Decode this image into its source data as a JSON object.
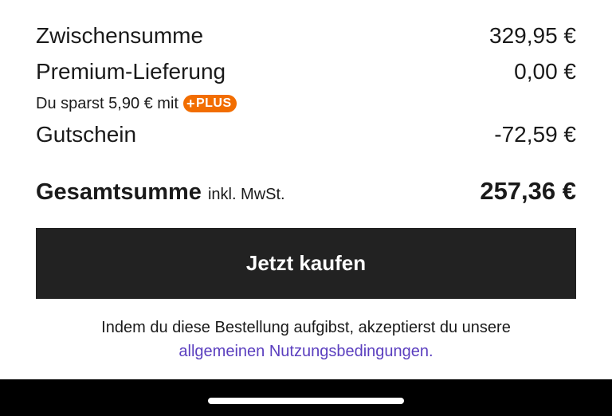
{
  "summary": {
    "subtotal_label": "Zwischensumme",
    "subtotal_value": "329,95 €",
    "delivery_label": "Premium-Lieferung",
    "delivery_value": "0,00 €",
    "saving_text": "Du sparst 5,90 € mit",
    "plus_badge": "PLUS",
    "plus_badge_sign": "+",
    "voucher_label": "Gutschein",
    "voucher_value": "-72,59 €",
    "total_label": "Gesamtsumme",
    "total_suffix": "inkl. MwSt.",
    "total_value": "257,36 €"
  },
  "buy_button_label": "Jetzt kaufen",
  "terms": {
    "text": "Indem du diese Bestellung aufgibst, akzeptierst du unsere",
    "link": "allgemeinen Nutzungsbedingungen."
  },
  "colors": {
    "button_bg": "#222222",
    "plus_badge": "#f26d00",
    "link": "#5b3fbf"
  }
}
